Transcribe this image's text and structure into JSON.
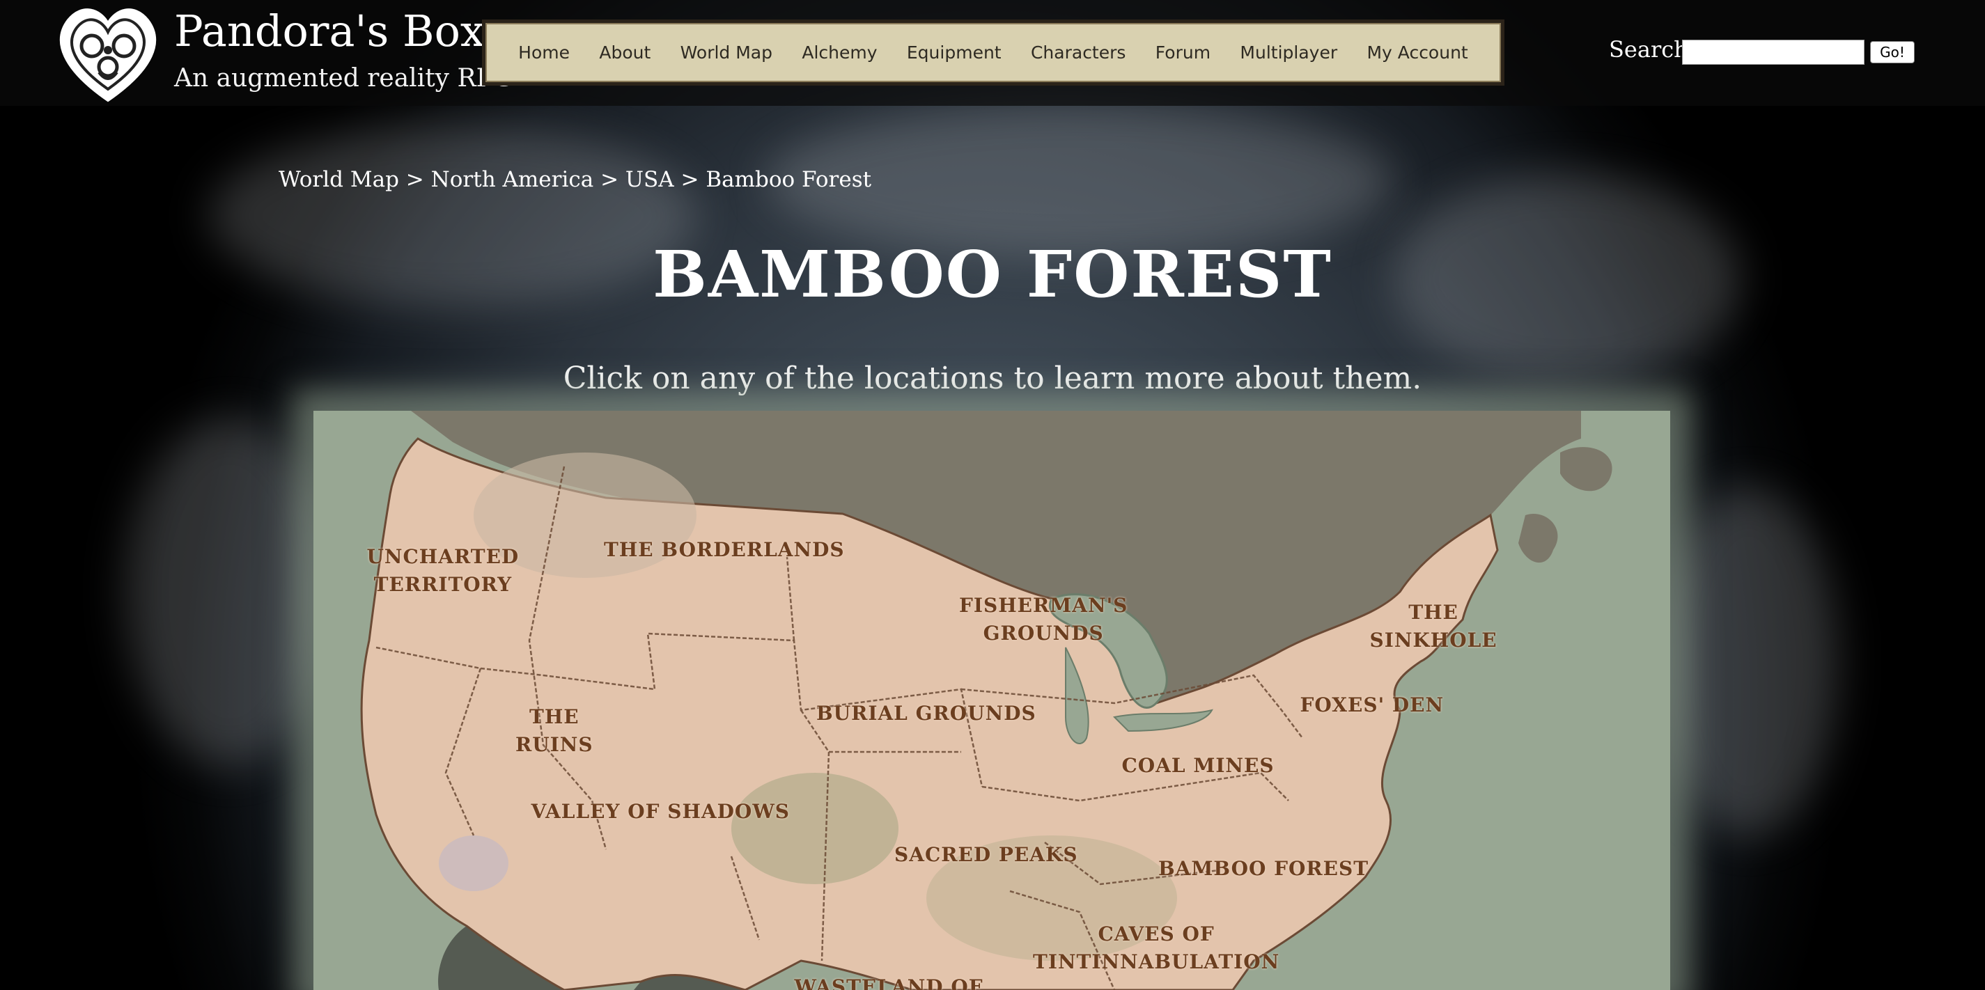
{
  "site": {
    "title": "Pandora's Box",
    "tagline": "An augmented reality RPG"
  },
  "nav": {
    "items": [
      "Home",
      "About",
      "World Map",
      "Alchemy",
      "Equipment",
      "Characters",
      "Forum",
      "Multiplayer",
      "My Account"
    ]
  },
  "search": {
    "label": "Search:",
    "value": "",
    "button": "Go!"
  },
  "breadcrumb": {
    "items": [
      "World Map",
      "North America",
      "USA",
      "Bamboo Forest"
    ],
    "separator": ">"
  },
  "page": {
    "title": "BAMBOO FOREST",
    "instructions": "Click on any of the locations to learn more about them."
  },
  "map": {
    "locations": [
      {
        "line1": "UNCHARTED",
        "line2": "TERRITORY"
      },
      {
        "line1": "THE BORDERLANDS",
        "line2": ""
      },
      {
        "line1": "FISHERMAN'S",
        "line2": "GROUNDS"
      },
      {
        "line1": "THE",
        "line2": "SINKHOLE"
      },
      {
        "line1": "THE",
        "line2": "RUINS"
      },
      {
        "line1": "BURIAL GROUNDS",
        "line2": ""
      },
      {
        "line1": "FOXES' DEN",
        "line2": ""
      },
      {
        "line1": "COAL MINES",
        "line2": ""
      },
      {
        "line1": "VALLEY OF SHADOWS",
        "line2": ""
      },
      {
        "line1": "SACRED PEAKS",
        "line2": ""
      },
      {
        "line1": "BAMBOO FOREST",
        "line2": ""
      },
      {
        "line1": "CAVES OF",
        "line2": "TINTINNABULATION"
      },
      {
        "line1": "WASTELAND OF",
        "line2": ""
      }
    ]
  },
  "colors": {
    "nav_bg": "#d9d1b0",
    "map_water": "#98a793",
    "map_land": "#e3c4ac",
    "label_text": "#6b3e1f"
  }
}
